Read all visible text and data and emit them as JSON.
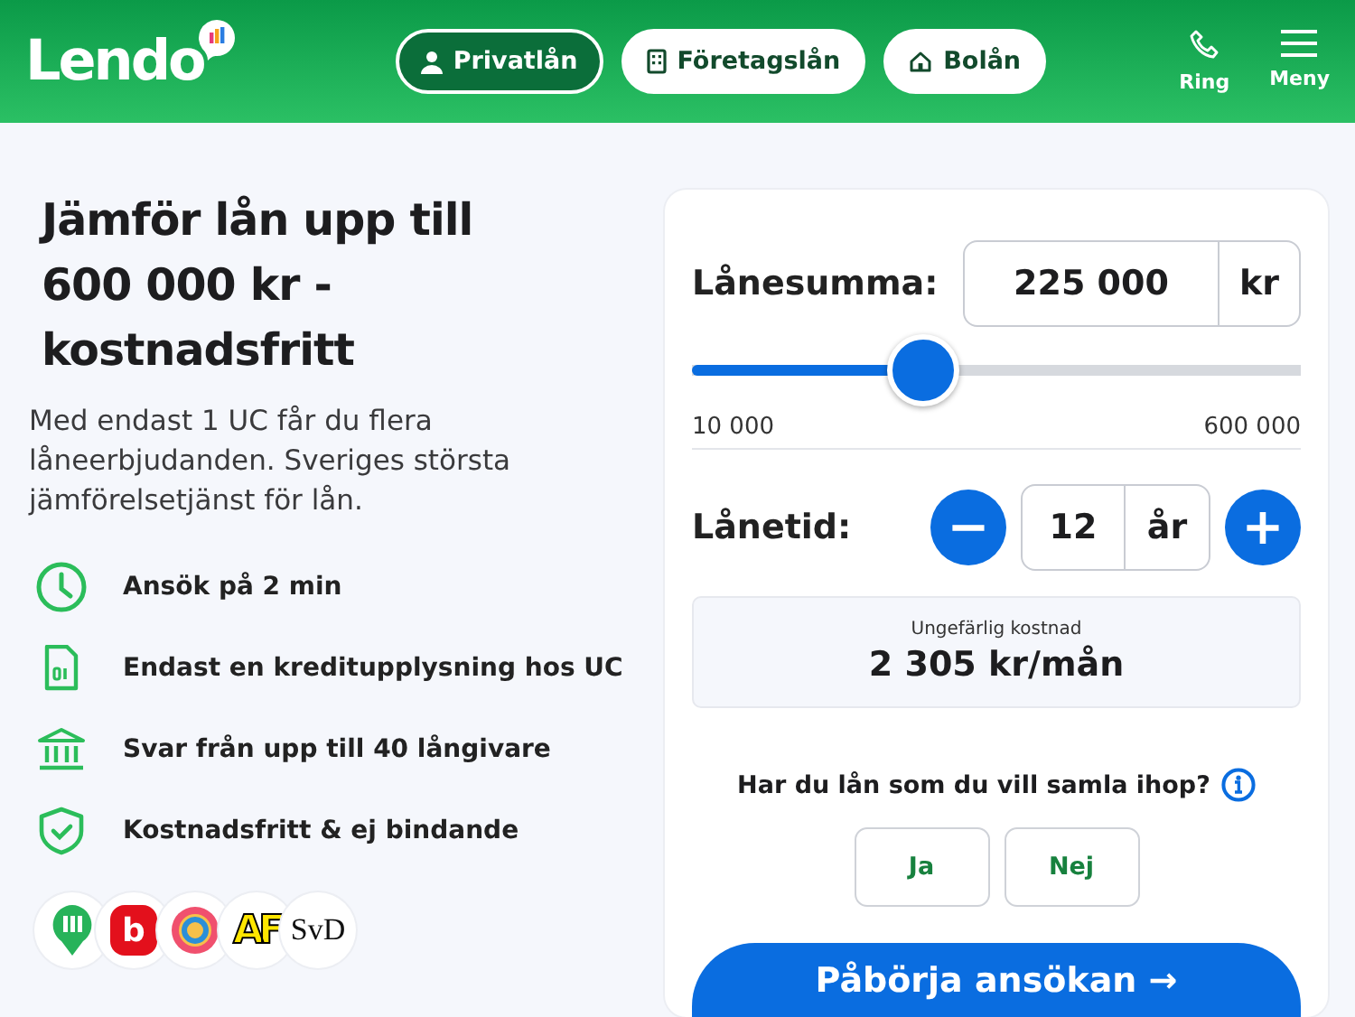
{
  "header": {
    "logo": "Lendo",
    "tabs": [
      {
        "label": "Privatlån",
        "kind": "person",
        "selected": true
      },
      {
        "label": "Företagslån",
        "kind": "building",
        "selected": false
      },
      {
        "label": "Bolån",
        "kind": "house",
        "selected": false
      }
    ],
    "actions": [
      {
        "label": "Ring",
        "kind": "phone"
      },
      {
        "label": "Meny",
        "kind": "menu"
      }
    ]
  },
  "hero": {
    "title": "Jämför lån upp till 600 000 kr - kostnadsfritt",
    "text": "Med endast 1 UC får du flera låneerbjudanden. Sveriges största jämförelsetjänst för lån.",
    "benefits": [
      {
        "kind": "clock",
        "text": "Ansök på 2 min"
      },
      {
        "kind": "document",
        "text": "Endast en kreditupplysning hos UC"
      },
      {
        "kind": "bank",
        "text": "Svar från upp till 40 långivare"
      },
      {
        "kind": "shield",
        "text": "Kostnadsfritt & ej bindande"
      }
    ],
    "partners": [
      {
        "kind": "pin"
      },
      {
        "kind": "letter",
        "text": "b"
      },
      {
        "kind": "ring"
      },
      {
        "kind": "bold",
        "text": "AF"
      },
      {
        "kind": "serif",
        "text": "SvD"
      }
    ]
  },
  "calculator": {
    "amount_label": "Lånesumma:",
    "amount": "225 000",
    "amount_unit": "kr",
    "slider": {
      "level": 0.38,
      "min": "10 000",
      "max": "600 000"
    },
    "term_label": "Lånetid:",
    "term": "12",
    "term_unit": "år",
    "minus": "−",
    "plus": "+",
    "cost_label": "Ungefärlig kostnad",
    "cost": "2 305 kr/mån",
    "question": "Har du lån som du vill samla ihop?",
    "answers": [
      {
        "label": "Ja",
        "selected": false
      },
      {
        "label": "Nej",
        "selected": false
      }
    ],
    "submit": "Påbörja ansökan →"
  }
}
